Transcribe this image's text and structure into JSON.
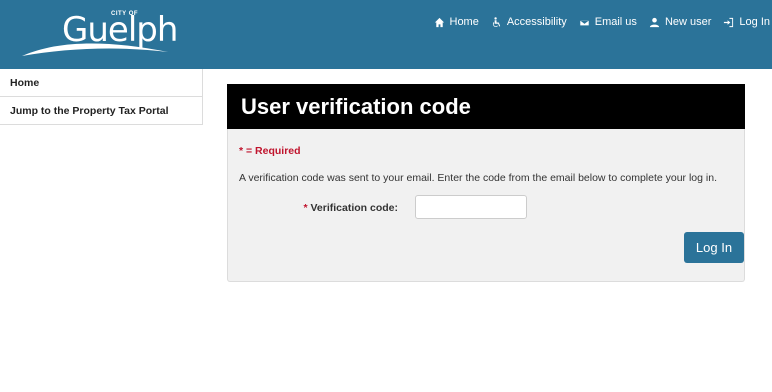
{
  "brand": {
    "logo_top": "CITY OF",
    "logo_main": "Guelph"
  },
  "topnav": {
    "home": "Home",
    "accessibility": "Accessibility",
    "email": "Email us",
    "new_user": "New user",
    "login": "Log In"
  },
  "sidebar": {
    "items": [
      {
        "label": "Home"
      },
      {
        "label": "Jump to the Property Tax Portal"
      }
    ]
  },
  "panel": {
    "title": "User verification code",
    "required_note": "* = Required",
    "message": "A verification code was sent to your email. Enter the code from the email below to complete your log in.",
    "field_label": "Verification code:",
    "field_star": "*",
    "field_value": "",
    "button": "Log In"
  },
  "colors": {
    "header": "#2b7399",
    "title_bar": "#000000",
    "required": "#c0142d",
    "button": "#2b7399"
  }
}
